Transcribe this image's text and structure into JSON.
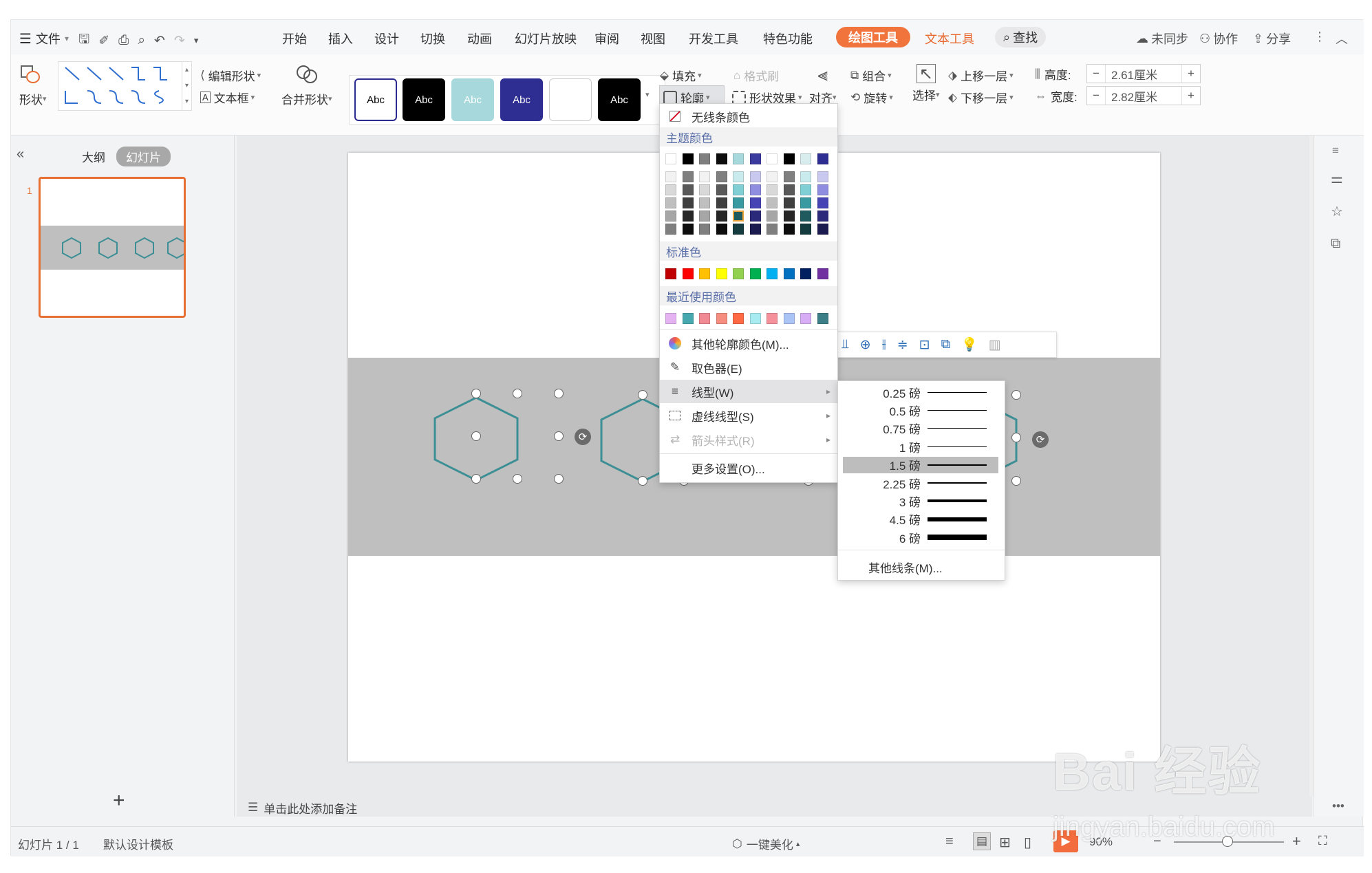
{
  "menubar": {
    "file": "文件",
    "tabs": [
      "开始",
      "插入",
      "设计",
      "切换",
      "动画",
      "幻灯片放映",
      "审阅",
      "视图",
      "开发工具",
      "特色功能"
    ],
    "drawing_tools": "绘图工具",
    "text_tools": "文本工具",
    "search": "查找",
    "sync": "未同步",
    "collab": "协作",
    "share": "分享"
  },
  "ribbon": {
    "shape": "形状",
    "edit_shape": "编辑形状",
    "textbox": "文本框",
    "merge_shape": "合并形状",
    "styles": [
      "Abc",
      "Abc",
      "Abc",
      "Abc",
      "",
      "Abc"
    ],
    "fill": "填充",
    "format_painter": "格式刷",
    "outline": "轮廓",
    "shape_effect": "形状效果",
    "align": "对齐",
    "group": "组合",
    "rotate": "旋转",
    "select": "选择",
    "bring_forward": "上移一层",
    "send_backward": "下移一层",
    "height_label": "高度:",
    "height_value": "2.61厘米",
    "width_label": "宽度:",
    "width_value": "2.82厘米",
    "minus": "−",
    "plus": "+"
  },
  "leftpanel": {
    "collapse": "«",
    "outline_tab": "大纲",
    "slides_tab": "幻灯片",
    "slide_number": "1",
    "add": "+"
  },
  "outline_menu": {
    "no_line": "无线条颜色",
    "theme_colors": "主题颜色",
    "standard_colors": "标准色",
    "recent_colors": "最近使用颜色",
    "more_colors": "其他轮廓颜色(M)...",
    "eyedropper": "取色器(E)",
    "line_type": "线型(W)",
    "dash_type": "虚线线型(S)",
    "arrow_style": "箭头样式(R)",
    "more_settings": "更多设置(O)...",
    "theme_row1": [
      "#ffffff",
      "#000000",
      "#7f7f7f",
      "#0d0d0d",
      "#a6d8dc",
      "#3b3a9e",
      "#ffffff",
      "#000000",
      "#d9ecee",
      "#2e2d91"
    ],
    "theme_grid": [
      [
        "#f2f2f2",
        "#7f7f7f",
        "#f2f2f2",
        "#7f7f7f",
        "#c9ebed",
        "#c9c8ef",
        "#f2f2f2",
        "#7f7f7f",
        "#c9ebed",
        "#c9c8ef"
      ],
      [
        "#d9d9d9",
        "#595959",
        "#d9d9d9",
        "#595959",
        "#7fcfd5",
        "#8f8de0",
        "#d9d9d9",
        "#595959",
        "#7fcfd5",
        "#8f8de0"
      ],
      [
        "#bfbfbf",
        "#3f3f3f",
        "#bfbfbf",
        "#3f3f3f",
        "#3a9aa2",
        "#4644b4",
        "#bfbfbf",
        "#3f3f3f",
        "#3a9aa2",
        "#4644b4"
      ],
      [
        "#a6a6a6",
        "#262626",
        "#a6a6a6",
        "#262626",
        "#1f5a5f",
        "#2b2a7a",
        "#a6a6a6",
        "#262626",
        "#1f5a5f",
        "#2b2a7a"
      ],
      [
        "#7f7f7f",
        "#0d0d0d",
        "#7f7f7f",
        "#0d0d0d",
        "#143b3e",
        "#1c1b50",
        "#7f7f7f",
        "#0d0d0d",
        "#143b3e",
        "#1c1b50"
      ]
    ],
    "standard": [
      "#c00000",
      "#ff0000",
      "#ffc000",
      "#ffff00",
      "#92d050",
      "#00b050",
      "#00b0f0",
      "#0070c0",
      "#002060",
      "#7030a0"
    ],
    "recent": [
      "#e6b3f2",
      "#47a8b0",
      "#f08a93",
      "#f58e7e",
      "#ff6a45",
      "#a8ecf2",
      "#f5919b",
      "#a9c4f5",
      "#d7aef5",
      "#3c7f86"
    ]
  },
  "line_submenu": {
    "options": [
      {
        "label": "0.25 磅",
        "weight": 0.25
      },
      {
        "label": "0.5 磅",
        "weight": 0.5
      },
      {
        "label": "0.75 磅",
        "weight": 0.75
      },
      {
        "label": "1 磅",
        "weight": 1
      },
      {
        "label": "1.5 磅",
        "weight": 1.5
      },
      {
        "label": "2.25 磅",
        "weight": 2.25
      },
      {
        "label": "3 磅",
        "weight": 3
      },
      {
        "label": "4.5 磅",
        "weight": 4.5
      },
      {
        "label": "6 磅",
        "weight": 6
      }
    ],
    "selected": "1.5 磅",
    "more_lines": "其他线条(M)..."
  },
  "notes": "单击此处添加备注",
  "status": {
    "slide_info": "幻灯片 1 / 1",
    "template": "默认设计模板",
    "beautify": "一键美化",
    "zoom": "90%"
  },
  "watermark": {
    "line1": "Bai 经验",
    "line2": "jingyan.baidu.com"
  },
  "colors": {
    "accent": "#f0743c",
    "hexagon": "#3c8f94",
    "band": "#bfbfbf",
    "selection": "#e86f34"
  }
}
